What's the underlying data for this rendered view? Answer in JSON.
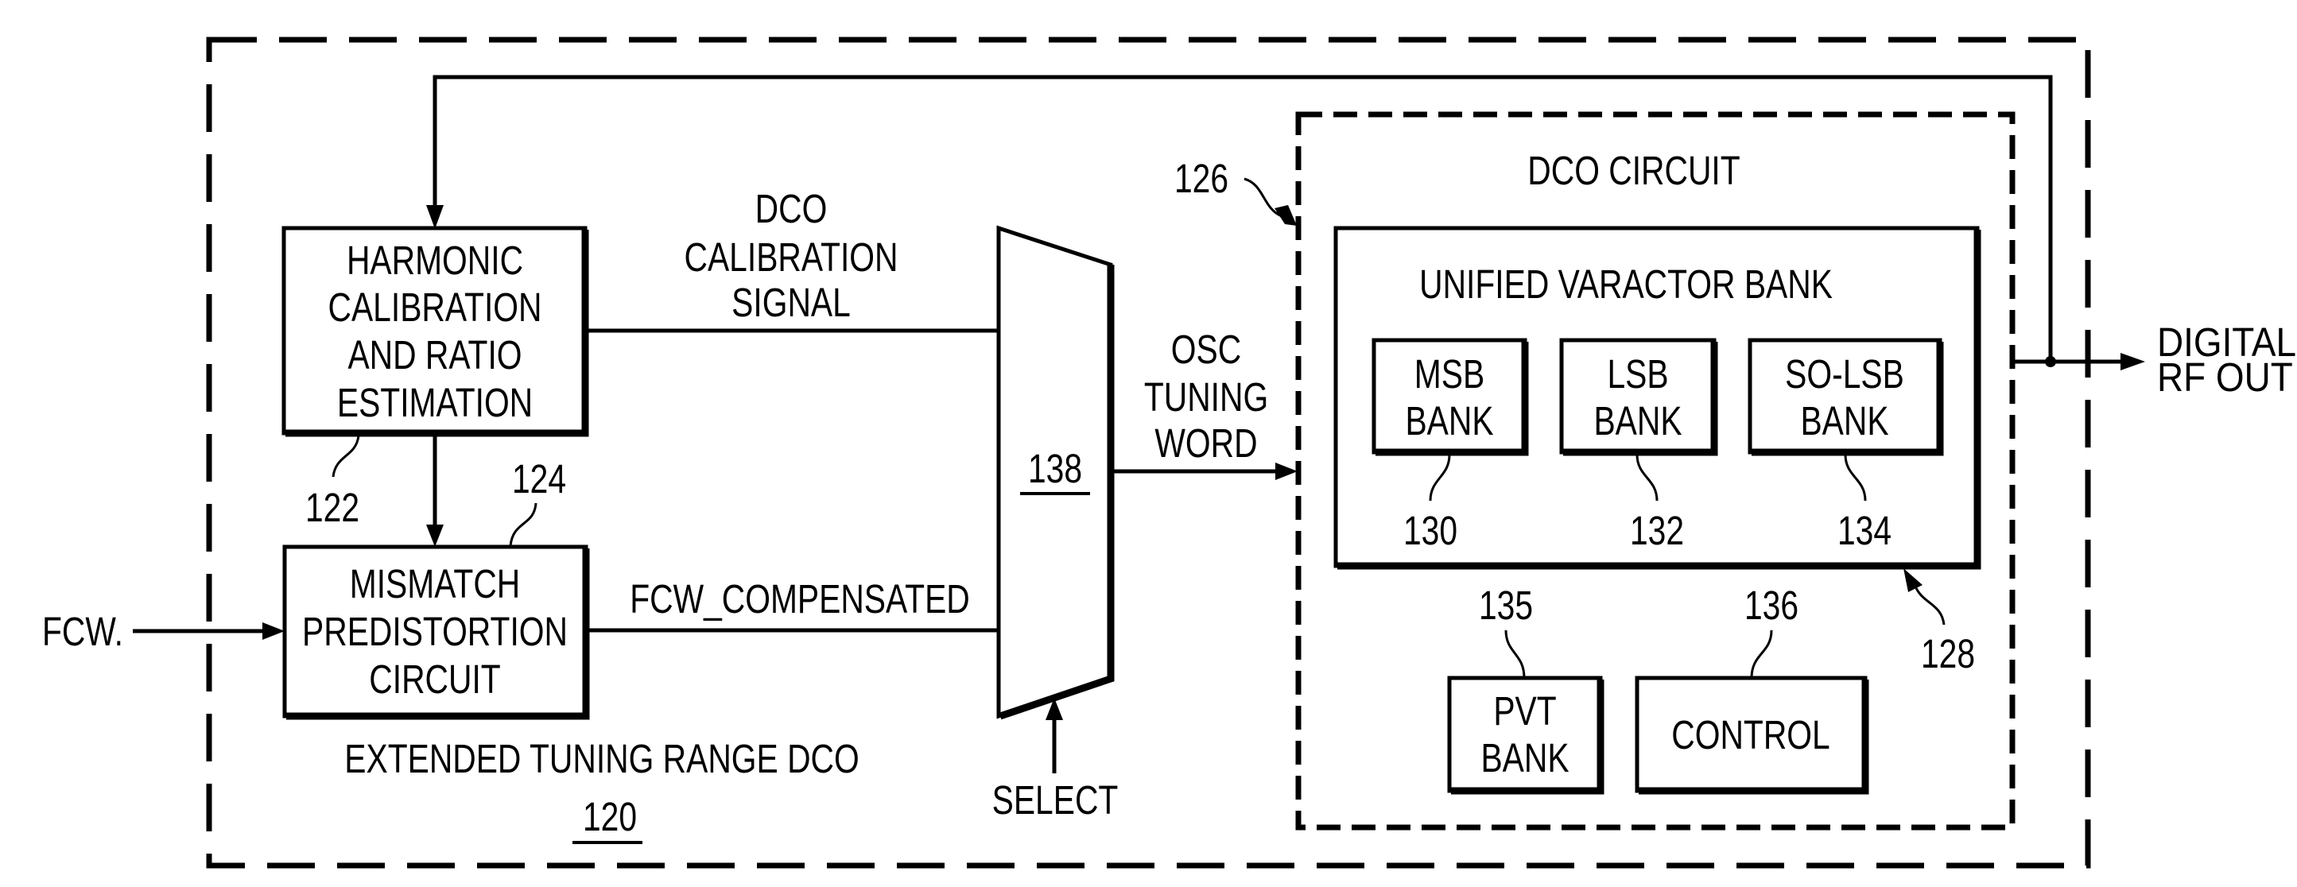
{
  "figure": {
    "outer_block": {
      "title": "EXTENDED TUNING RANGE DCO",
      "ref": "120"
    },
    "harmonic_block": {
      "lines": [
        "HARMONIC",
        "CALIBRATION",
        "AND RATIO",
        "ESTIMATION"
      ],
      "ref": "122"
    },
    "mismatch_block": {
      "lines": [
        "MISMATCH",
        "PREDISTORTION",
        "CIRCUIT"
      ],
      "ref": "124"
    },
    "mux": {
      "ref": "138",
      "select_label": "SELECT"
    },
    "signals": {
      "fcw_input": "FCW.",
      "dco_calibration": [
        "DCO",
        "CALIBRATION",
        "SIGNAL"
      ],
      "fcw_compensated": "FCW_COMPENSATED",
      "osc_tuning_word": [
        "OSC",
        "TUNING",
        "WORD"
      ],
      "output": [
        "DIGITAL",
        "RF OUT"
      ]
    },
    "dco_circuit": {
      "title": "DCO CIRCUIT",
      "ref": "126",
      "varactor_bank": {
        "title": "UNIFIED VARACTOR BANK",
        "ref": "128",
        "banks": [
          {
            "lines": [
              "MSB",
              "BANK"
            ],
            "ref": "130"
          },
          {
            "lines": [
              "LSB",
              "BANK"
            ],
            "ref": "132"
          },
          {
            "lines": [
              "SO-LSB",
              "BANK"
            ],
            "ref": "134"
          }
        ]
      },
      "pvt_bank": {
        "lines": [
          "PVT",
          "BANK"
        ],
        "ref": "135"
      },
      "control": {
        "label": "CONTROL",
        "ref": "136"
      }
    },
    "colors": {
      "ink": "#000000",
      "background": "#ffffff"
    }
  }
}
